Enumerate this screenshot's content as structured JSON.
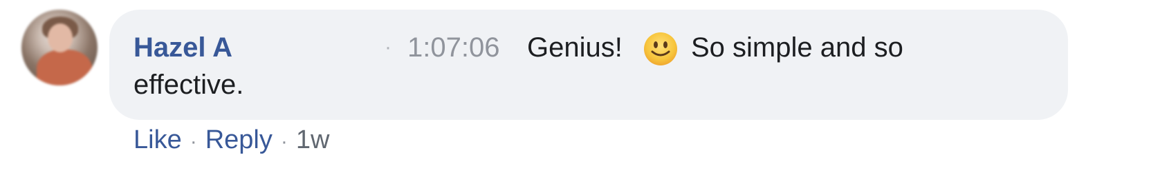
{
  "comment": {
    "author": "Hazel A",
    "separator": "·",
    "timestamp": "1:07:06",
    "text_part1": "Genius!",
    "emoji": "slightly-smiling-face",
    "text_part2": "So simple and so",
    "text_line2": "effective."
  },
  "actions": {
    "like": "Like",
    "dot1": "·",
    "reply": "Reply",
    "dot2": "·",
    "age": "1w"
  },
  "colors": {
    "author": "#385898",
    "bubble": "#f0f2f5",
    "text": "#1c1e21",
    "muted": "#90949c"
  }
}
